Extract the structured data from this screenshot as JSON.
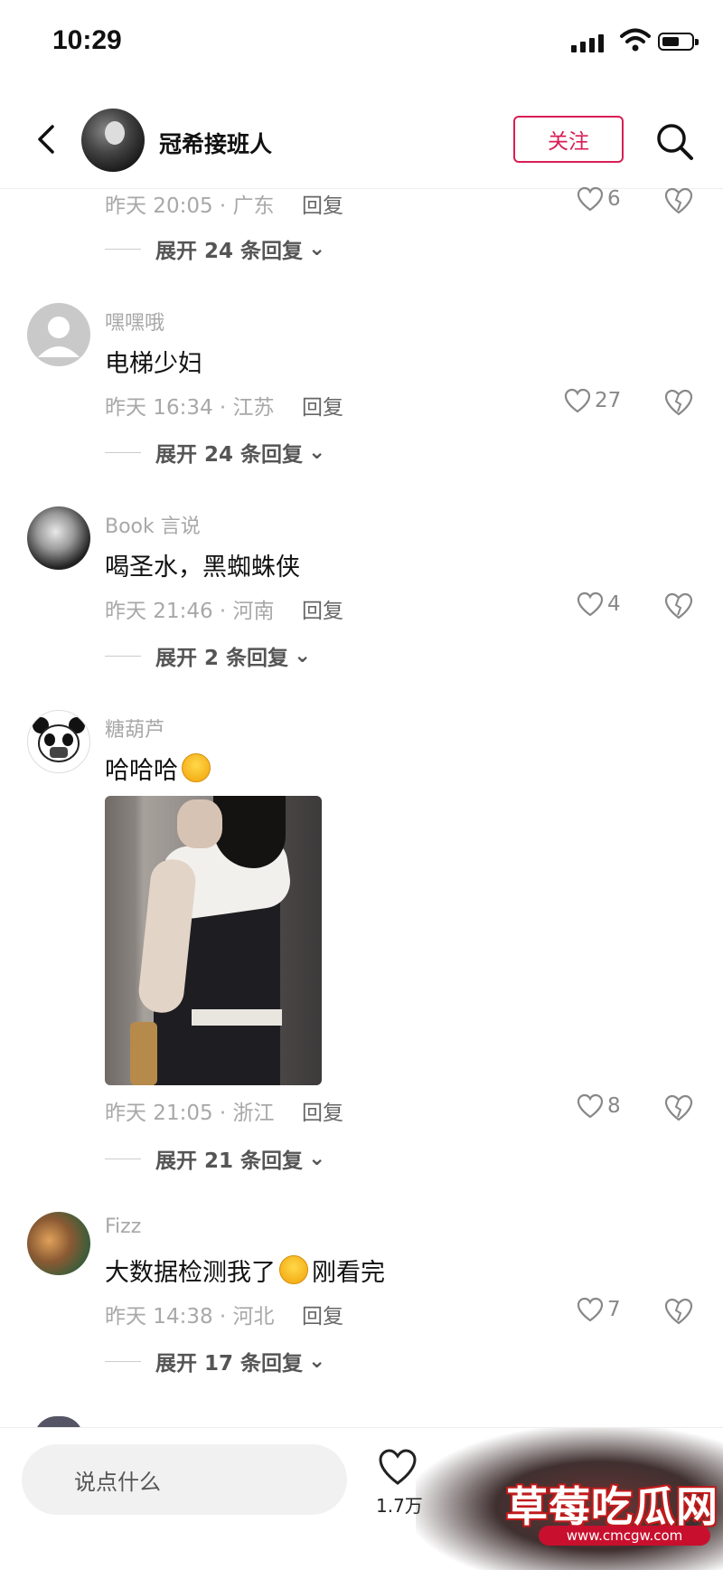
{
  "status_bar": {
    "time": "10:29"
  },
  "header": {
    "name": "冠希接班人",
    "follow_label": "关注"
  },
  "comments": [
    {
      "user": "",
      "text": "",
      "meta": "昨天 20:05 · 广东",
      "reply": "回复",
      "likes": "6",
      "expand": "展开 24 条回复"
    },
    {
      "user": "嘿嘿哦",
      "text": "电梯少妇",
      "meta": "昨天 16:34 · 江苏",
      "reply": "回复",
      "likes": "27",
      "expand": "展开 24 条回复"
    },
    {
      "user": "Book 言说",
      "text": "喝圣水，黑蜘蛛侠",
      "meta": "昨天 21:46 · 河南",
      "reply": "回复",
      "likes": "4",
      "expand": "展开 2 条回复"
    },
    {
      "user": "糖葫芦",
      "text": "哈哈哈",
      "meta": "昨天 21:05 · 浙江",
      "reply": "回复",
      "likes": "8",
      "expand": "展开 21 条回复"
    },
    {
      "user": "Fizz",
      "text": "大数据检测我了",
      "text_after": "刚看完",
      "meta": "昨天 14:38 · 河北",
      "reply": "回复",
      "likes": "7",
      "expand": "展开 17 条回复"
    }
  ],
  "bottom_bar": {
    "input_placeholder": "说点什么",
    "like_count": "1.7万"
  },
  "watermark": {
    "text": "草莓吃瓜网",
    "url": "www.cmcgw.com"
  },
  "colors": {
    "accent": "#d81e55",
    "muted": "#a8a8a8"
  }
}
